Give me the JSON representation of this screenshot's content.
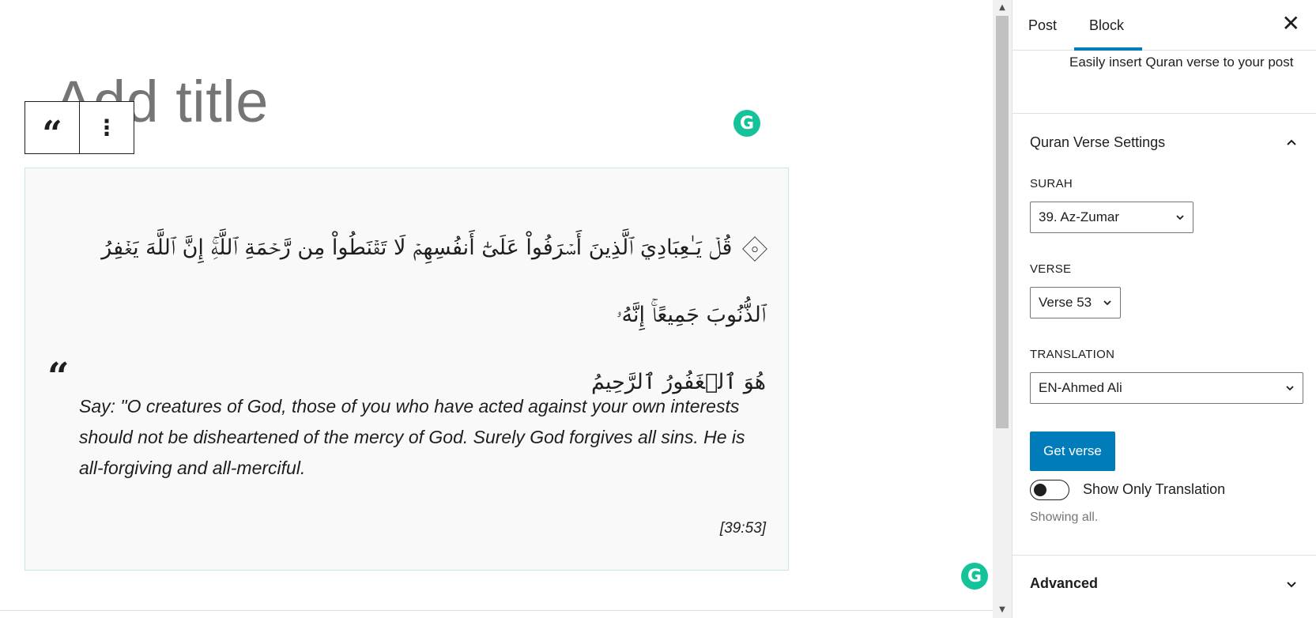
{
  "editor": {
    "title_placeholder": "Add title",
    "toolbar": {
      "quote_glyph": "“",
      "more_glyph": "⋮"
    },
    "grammarly_glyph": "G",
    "quran_block": {
      "arabic_line_1": "قُلۡ يَـٰعِبَادِيَ ٱلَّذِينَ أَسۡرَفُواْ عَلَىٰٓ أَنفُسِهِمۡ لَا تَقۡنَطُواْ مِن رَّحۡمَةِ ٱللَّهِۚ إِنَّ ٱللَّهَ يَغۡفِرُ ٱلذُّنُوبَ جَمِيعًاۚ إِنَّهُۥ",
      "arabic_line_2": "هُوَ ٱلۡغَفُورُ ٱلرَّحِيمُ",
      "quote_mark": "“",
      "translation": "Say: \"O creatures of God, those of you who have acted against your own interests should not be disheartened of the mercy of God. Surely God forgives all sins. He is all-forgiving and all-merciful.",
      "reference": "[39:53]"
    }
  },
  "scrollbar": {
    "up_arrow": "▲",
    "down_arrow": "▼"
  },
  "sidebar": {
    "tabs": [
      {
        "label": "Post",
        "active": false
      },
      {
        "label": "Block",
        "active": true
      }
    ],
    "close_glyph": "✕",
    "block_description": "Easily insert Quran verse to your post",
    "settings_panel": {
      "title": "Quran Verse Settings",
      "expanded": true,
      "surah": {
        "label": "SURAH",
        "value": "39. Az-Zumar"
      },
      "verse": {
        "label": "VERSE",
        "value": "Verse 53"
      },
      "translation": {
        "label": "TRANSLATION",
        "value": "EN-Ahmed Ali"
      },
      "get_verse_button": "Get verse",
      "toggle": {
        "label": "Show Only Translation",
        "checked": false
      },
      "help_text": "Showing all."
    },
    "advanced_panel": {
      "title": "Advanced",
      "expanded": false
    }
  },
  "colors": {
    "accent": "#007cba",
    "grammarly": "#15c39a",
    "block_background": "#f9f9f9",
    "block_border": "#c9e8e0"
  }
}
